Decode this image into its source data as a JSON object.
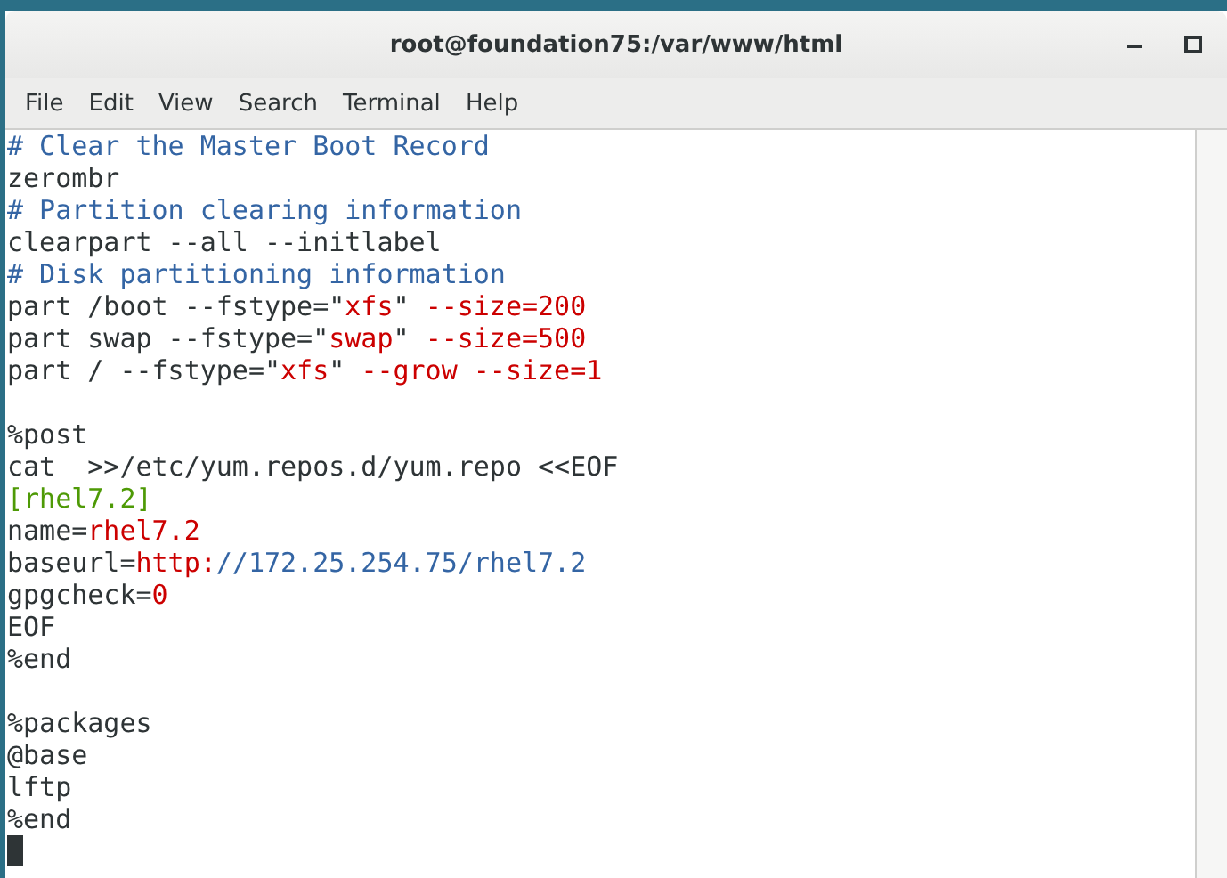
{
  "window": {
    "title": "root@foundation75:/var/www/html"
  },
  "menu": [
    "File",
    "Edit",
    "View",
    "Search",
    "Terminal",
    "Help"
  ],
  "lines": [
    {
      "kind": "code",
      "segments": [
        {
          "text": "# Clear the Master Boot Record",
          "kind": "comment"
        }
      ]
    },
    {
      "kind": "code",
      "segments": [
        {
          "text": "zerombr",
          "kind": "plain"
        }
      ]
    },
    {
      "kind": "code",
      "segments": [
        {
          "text": "# Partition clearing information",
          "kind": "comment"
        }
      ]
    },
    {
      "kind": "code",
      "segments": [
        {
          "text": "clearpart --all --initlabel",
          "kind": "plain"
        }
      ]
    },
    {
      "kind": "code",
      "segments": [
        {
          "text": "# Disk partitioning information",
          "kind": "comment"
        }
      ]
    },
    {
      "kind": "code",
      "segments": [
        {
          "text": "part /boot --fstype=\"",
          "kind": "plain"
        },
        {
          "text": "xfs",
          "kind": "string"
        },
        {
          "text": "\" ",
          "kind": "plain"
        },
        {
          "text": "--size=200",
          "kind": "string"
        }
      ]
    },
    {
      "kind": "code",
      "segments": [
        {
          "text": "part swap --fstype=\"",
          "kind": "plain"
        },
        {
          "text": "swap",
          "kind": "string"
        },
        {
          "text": "\" ",
          "kind": "plain"
        },
        {
          "text": "--size=500",
          "kind": "string"
        }
      ]
    },
    {
      "kind": "code",
      "segments": [
        {
          "text": "part / --fstype=\"",
          "kind": "plain"
        },
        {
          "text": "xfs",
          "kind": "string"
        },
        {
          "text": "\" ",
          "kind": "plain"
        },
        {
          "text": "--grow --size=1",
          "kind": "string"
        }
      ]
    },
    {
      "kind": "blank"
    },
    {
      "kind": "code",
      "segments": [
        {
          "text": "%post",
          "kind": "plain"
        }
      ]
    },
    {
      "kind": "code",
      "segments": [
        {
          "text": "cat  >>/etc/yum.repos.d/yum.repo <<EOF",
          "kind": "plain"
        }
      ]
    },
    {
      "kind": "code",
      "segments": [
        {
          "text": "[rhel7.2]",
          "kind": "section"
        }
      ]
    },
    {
      "kind": "code",
      "segments": [
        {
          "text": "name=",
          "kind": "plain"
        },
        {
          "text": "rhel7.2",
          "kind": "string"
        }
      ]
    },
    {
      "kind": "code",
      "segments": [
        {
          "text": "baseurl=",
          "kind": "plain"
        },
        {
          "text": "http:",
          "kind": "string"
        },
        {
          "text": "//172.25.254.75/rhel7.2",
          "kind": "comment"
        }
      ]
    },
    {
      "kind": "code",
      "segments": [
        {
          "text": "gpgcheck=",
          "kind": "plain"
        },
        {
          "text": "0",
          "kind": "string"
        }
      ]
    },
    {
      "kind": "code",
      "segments": [
        {
          "text": "EOF",
          "kind": "plain"
        }
      ]
    },
    {
      "kind": "code",
      "segments": [
        {
          "text": "%end",
          "kind": "plain"
        }
      ]
    },
    {
      "kind": "blank"
    },
    {
      "kind": "code",
      "segments": [
        {
          "text": "%packages",
          "kind": "plain"
        }
      ]
    },
    {
      "kind": "code",
      "segments": [
        {
          "text": "@base",
          "kind": "plain"
        }
      ]
    },
    {
      "kind": "code",
      "segments": [
        {
          "text": "lftp",
          "kind": "plain"
        }
      ]
    },
    {
      "kind": "code",
      "segments": [
        {
          "text": "%end",
          "kind": "plain"
        }
      ]
    },
    {
      "kind": "cursor"
    }
  ]
}
